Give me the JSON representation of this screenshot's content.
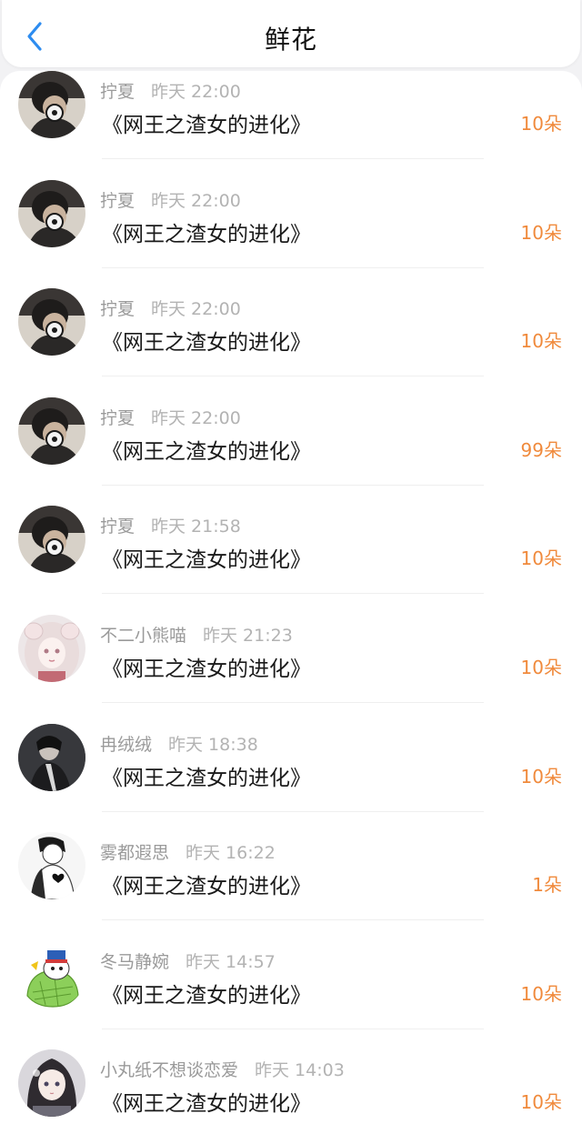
{
  "header": {
    "title": "鲜花",
    "back_icon": "chevron-left-icon",
    "accent_color": "#2d8cf0"
  },
  "amount_color": "#f08a3c",
  "rows": [
    {
      "user": "拧夏",
      "time": "昨天 22:00",
      "book": "《网王之渣女的进化》",
      "amount": "10朵",
      "avatar": "boy-headphones-avatar"
    },
    {
      "user": "拧夏",
      "time": "昨天 22:00",
      "book": "《网王之渣女的进化》",
      "amount": "10朵",
      "avatar": "boy-headphones-avatar"
    },
    {
      "user": "拧夏",
      "time": "昨天 22:00",
      "book": "《网王之渣女的进化》",
      "amount": "10朵",
      "avatar": "boy-headphones-avatar"
    },
    {
      "user": "拧夏",
      "time": "昨天 22:00",
      "book": "《网王之渣女的进化》",
      "amount": "99朵",
      "avatar": "boy-headphones-avatar"
    },
    {
      "user": "拧夏",
      "time": "昨天 21:58",
      "book": "《网王之渣女的进化》",
      "amount": "10朵",
      "avatar": "boy-headphones-avatar"
    },
    {
      "user": "不二小熊喵",
      "time": "昨天 21:23",
      "book": "《网王之渣女的进化》",
      "amount": "10朵",
      "avatar": "anime-girl-pink-avatar"
    },
    {
      "user": "冉绒绒",
      "time": "昨天 18:38",
      "book": "《网王之渣女的进化》",
      "amount": "10朵",
      "avatar": "dark-figure-avatar"
    },
    {
      "user": "雾都遐思",
      "time": "昨天 16:22",
      "book": "《网王之渣女的进化》",
      "amount": "1朵",
      "avatar": "sketch-heart-avatar"
    },
    {
      "user": "冬马静婉",
      "time": "昨天 14:57",
      "book": "《网王之渣女的进化》",
      "amount": "10朵",
      "avatar": "cartoon-mascot-avatar"
    },
    {
      "user": "小丸纸不想谈恋爱",
      "time": "昨天 14:03",
      "book": "《网王之渣女的进化》",
      "amount": "10朵",
      "avatar": "anime-girl-avatar"
    }
  ]
}
